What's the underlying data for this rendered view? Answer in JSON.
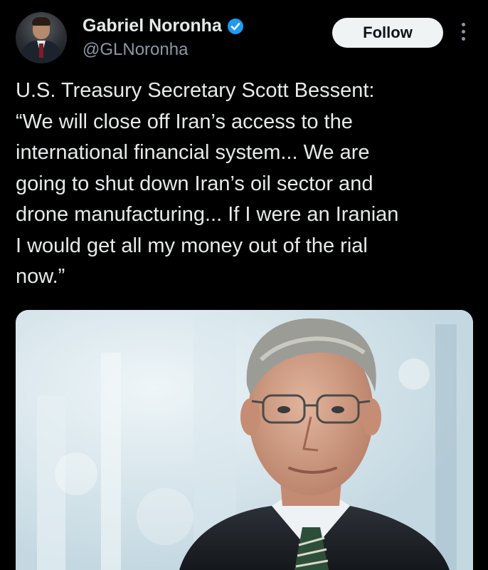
{
  "author": {
    "display_name": "Gabriel Noronha",
    "handle": "@GLNoronha",
    "verified": true,
    "avatar_icon": "profile-photo-man-in-suit"
  },
  "actions": {
    "follow_label": "Follow",
    "more_icon": "vertical-ellipsis-icon"
  },
  "tweet": {
    "text": "U.S. Treasury Secretary Scott Bessent:\n“We will close off Iran’s access to the\ninternational financial system... We are\ngoing to shut down Iran’s oil sector and\ndrone manufacturing... If I were an Iranian\nI would get all my money out of the rial\nnow.”"
  },
  "media": {
    "type": "photo",
    "subject": "portrait-older-man-glasses-suit-tie"
  },
  "colors": {
    "background": "#000000",
    "text": "#e7e9ea",
    "muted": "#8b98a5",
    "verified": "#1d9bf0",
    "follow_bg": "#eff3f4"
  }
}
